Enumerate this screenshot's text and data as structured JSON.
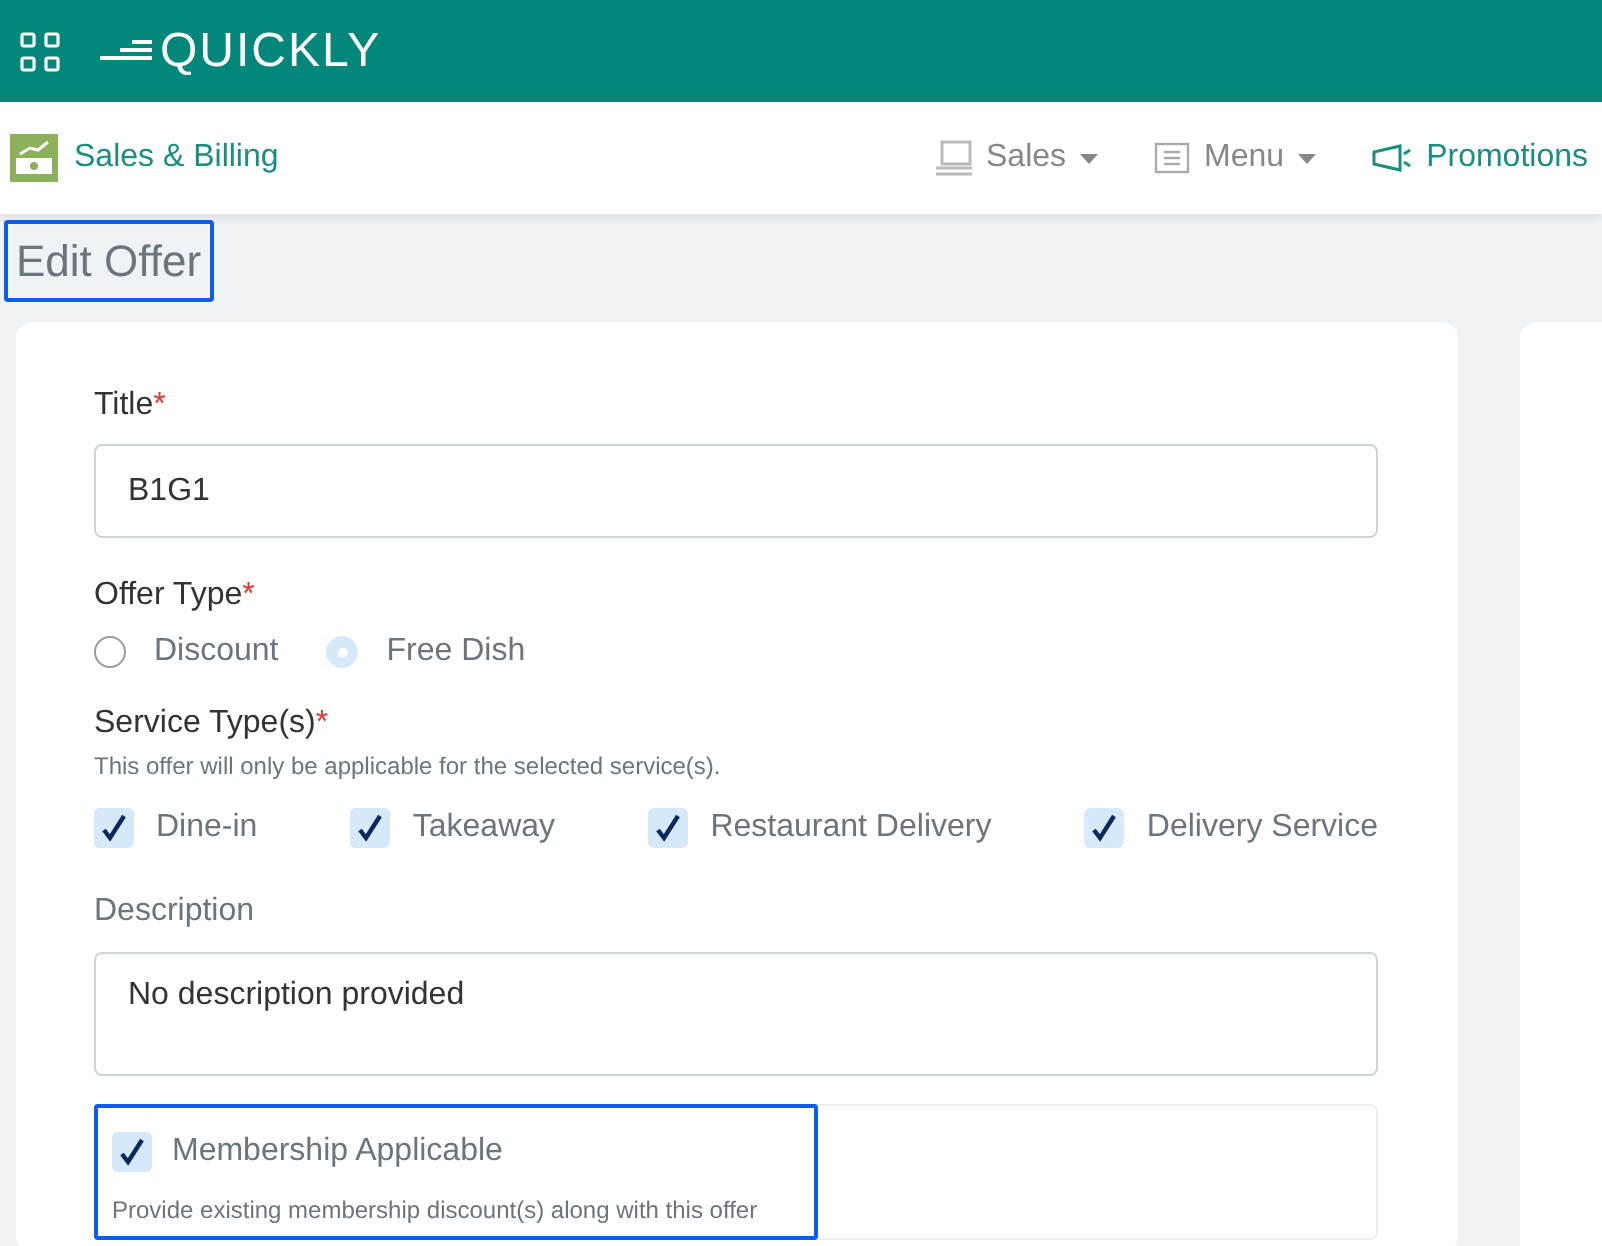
{
  "header": {
    "logo": "QUICKLY"
  },
  "nav": {
    "module": "Sales & Billing",
    "items": [
      {
        "label": "Sales",
        "kind": "dropdown",
        "selected": false
      },
      {
        "label": "Menu",
        "kind": "dropdown",
        "selected": false
      },
      {
        "label": "Promotions",
        "kind": "link",
        "selected": true
      }
    ]
  },
  "page_title": {
    "text": "Edit Offer",
    "highlighted": true
  },
  "form": {
    "title": {
      "label": "Title",
      "required": "*",
      "value": "B1G1"
    },
    "offer_type": {
      "label": "Offer Type",
      "required": "*",
      "options": [
        {
          "label": "Discount",
          "selected": false
        },
        {
          "label": "Free Dish",
          "selected": true
        }
      ]
    },
    "service_types": {
      "label": "Service Type(s)",
      "required": "*",
      "help": "This offer will only be applicable for the selected service(s).",
      "options": [
        {
          "label": "Dine-in",
          "checked": true
        },
        {
          "label": "Takeaway",
          "checked": true
        },
        {
          "label": "Restaurant Delivery",
          "checked": true
        },
        {
          "label": "Delivery Service",
          "checked": true
        }
      ]
    },
    "description": {
      "label": "Description",
      "value": "No description provided"
    },
    "membership": {
      "label": "Membership Applicable",
      "checked": true,
      "help": "Provide existing membership discount(s) along with this offer",
      "highlighted": true
    }
  }
}
